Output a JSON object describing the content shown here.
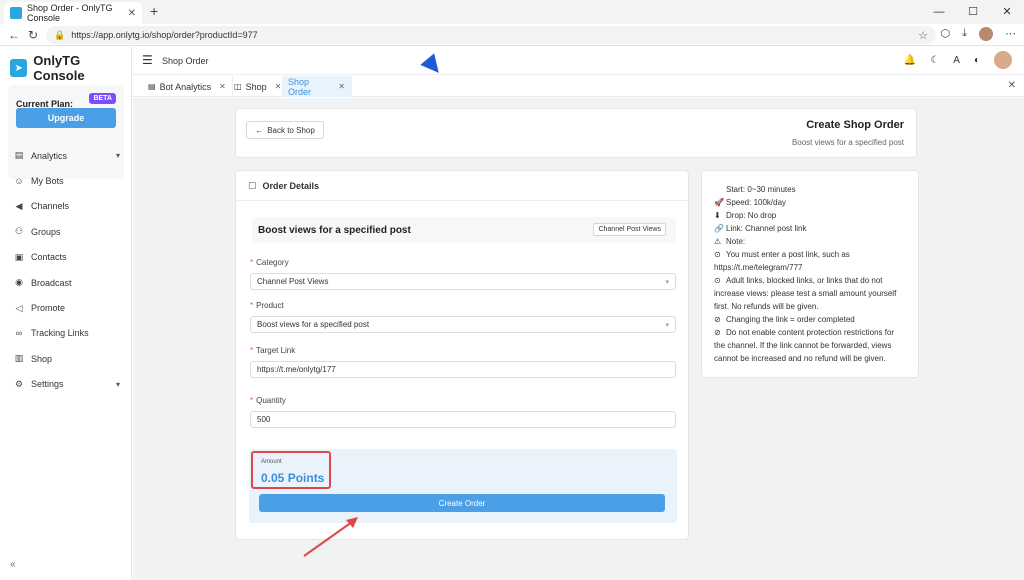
{
  "browser": {
    "tab_title": "Shop Order - OnlyTG Console",
    "url": "https://app.onlytg.io/shop/order?productId=977"
  },
  "sidebar": {
    "brand": "OnlyTG Console",
    "plan_label": "Current Plan:",
    "plan_badge": "BETA",
    "upgrade_label": "Upgrade",
    "items": [
      {
        "label": "Analytics",
        "icon": "chart-icon",
        "has_chevron": true
      },
      {
        "label": "My Bots",
        "icon": "bot-icon"
      },
      {
        "label": "Channels",
        "icon": "megaphone-icon"
      },
      {
        "label": "Groups",
        "icon": "users-icon"
      },
      {
        "label": "Contacts",
        "icon": "contacts-icon"
      },
      {
        "label": "Broadcast",
        "icon": "broadcast-icon"
      },
      {
        "label": "Promote",
        "icon": "promote-icon"
      },
      {
        "label": "Tracking Links",
        "icon": "link-icon"
      },
      {
        "label": "Shop",
        "icon": "shop-icon"
      },
      {
        "label": "Settings",
        "icon": "gear-icon",
        "has_chevron": true
      }
    ]
  },
  "topbar": {
    "title": "Shop Order"
  },
  "tabs": [
    {
      "label": "Bot Analytics",
      "icon": "chart-icon"
    },
    {
      "label": "Shop",
      "icon": "bag-icon"
    },
    {
      "label": "Shop Order",
      "active": true
    }
  ],
  "header": {
    "back_label": "Back to Shop",
    "title": "Create Shop Order",
    "subtitle": "Boost views for a specified post"
  },
  "order": {
    "section_title": "Order Details",
    "product_title": "Boost views for a specified post",
    "product_tag": "Channel Post Views",
    "category_label": "Category",
    "category_value": "Channel Post Views",
    "product_label": "Product",
    "product_value": "Boost views for a specified post",
    "link_label": "Target Link",
    "link_value": "https://t.me/onlytg/177",
    "quantity_label": "Quantity",
    "quantity_value": "500",
    "amount_label": "Amount",
    "amount_value": "0.05 Points",
    "create_label": "Create Order"
  },
  "info": {
    "lines": [
      {
        "icon": "",
        "text": "Start: 0~30 minutes"
      },
      {
        "icon": "🚀",
        "text": "Speed: 100k/day"
      },
      {
        "icon": "⬇",
        "text": "Drop: No drop"
      },
      {
        "icon": "🔗",
        "text": "Link: Channel post link"
      },
      {
        "icon": "⚠",
        "text": "Note:"
      },
      {
        "icon": "⊙",
        "text": "You must enter a post link, such as https://t.me/telegram/777"
      },
      {
        "icon": "⊙",
        "text": "Adult links, blocked links, or links that do not increase views: please test a small amount yourself first. No refunds will be given."
      },
      {
        "icon": "⊘",
        "text": "Changing the link = order completed"
      },
      {
        "icon": "⊘",
        "text": "Do not enable content protection restrictions for the channel. If the link cannot be forwarded, views cannot be increased and no refund will be given."
      }
    ]
  },
  "colors": {
    "accent": "#4a9fe6",
    "highlight": "#e04848",
    "beta": "#7c4dff"
  }
}
